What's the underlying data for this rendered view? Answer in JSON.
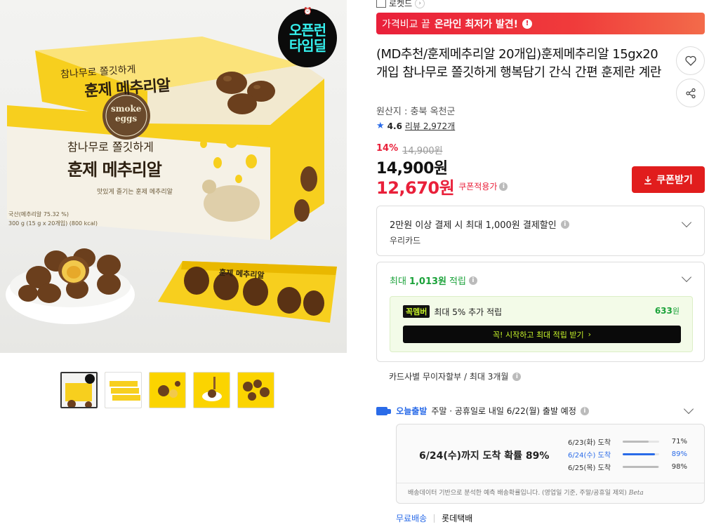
{
  "breadcrumb": {
    "label": "로켓드"
  },
  "promo": {
    "prefix": "가격비교 끝",
    "highlight": "온라인 최저가 발견!",
    "info": "!"
  },
  "badge": {
    "line1": "오픈런",
    "line2": "타임딜"
  },
  "product_image": {
    "box_headline_small": "참나무로 쫄깃하게",
    "box_headline_big": "훈제 메추리알",
    "side_headline_small": "참나무로 쫄깃하게",
    "side_headline_big": "훈제 메추리알",
    "logo_top": "smoke",
    "logo_bottom": "eggs",
    "tagline": "맛있게 즐기는 훈제 메추리알",
    "weight": "300 g (15 g x 20개입) (800 kcal)",
    "origin_line": "국산(메추리알 75.32 %)",
    "pack_label": "훈제 메추리알",
    "colors": {
      "box_yellow": "#f7cf1e",
      "egg_brown": "#6b3f1d"
    }
  },
  "thumbnails": [
    "썸네일1",
    "썸네일2",
    "썸네일3",
    "썸네일4",
    "썸네일5"
  ],
  "title": "(MD추천/훈제메추리알 20개입)훈제메추리알 15gx20개입 참나무로 쫄깃하게 행복담기 간식 간편 훈제란 계란",
  "origin": "원산지 : 충북 옥천군",
  "rating": {
    "score": "4.6",
    "reviews": "리뷰 2,972개"
  },
  "price": {
    "discount": "14%",
    "original": "14,900원",
    "sale": "14,900원",
    "coupon_price": "12,670원",
    "coupon_label": "쿠폰적용가"
  },
  "coupon_button": "쿠폰받기",
  "card_discount": {
    "line1": "2만원 이상 결제 시 최대 1,000원 결제할인",
    "line2": "우리카드"
  },
  "points": {
    "prefix": "최대",
    "amount": "1,013원",
    "suffix": "적립",
    "member_tag_a": "꼭",
    "member_tag_b": "멤버",
    "member_text": "최대 5% 추가 적립",
    "member_amount": "633",
    "member_unit": "원",
    "cta": "꼭! 시작하고 최대 적립 받기",
    "cta_arrow": "›"
  },
  "installment": "카드사별 무이자할부 / 최대 3개월",
  "shipping": {
    "today": "오늘출발",
    "text": "주말 · 공휴일로 내일 6/22(월) 출발 예정",
    "big": "6/24(수)까지 도착 확률 89%",
    "rows": [
      {
        "date": "6/23(화) 도착",
        "pct": "71%",
        "value": 0.71
      },
      {
        "date": "6/24(수) 도착",
        "pct": "89%",
        "value": 0.89
      },
      {
        "date": "6/25(목) 도착",
        "pct": "98%",
        "value": 0.98
      }
    ],
    "footnote": "배송데이터 기반으로 분석한 예측 배송확률입니다. (영업일 기준, 주말/공휴일 제외)",
    "beta": "Beta"
  },
  "courier": {
    "free": "무료배송",
    "name": "롯데택배"
  }
}
